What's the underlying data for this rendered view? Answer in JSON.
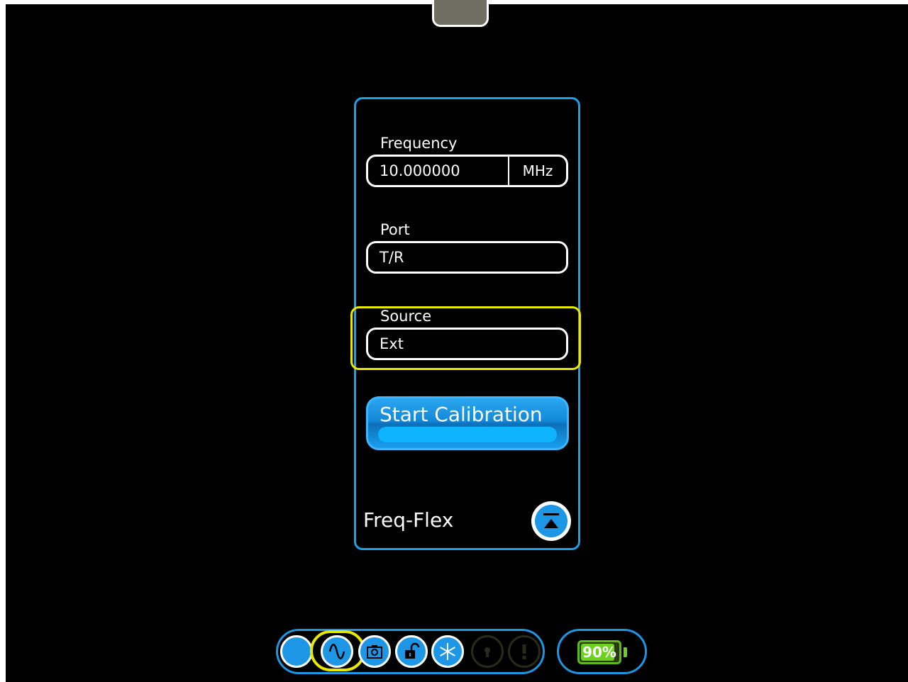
{
  "panel": {
    "frequency": {
      "label": "Frequency",
      "value": "10.000000",
      "unit": "MHz"
    },
    "port": {
      "label": "Port",
      "value": "T/R"
    },
    "source": {
      "label": "Source",
      "value": "Ext"
    },
    "start_button_label": "Start Calibration",
    "title": "Freq-Flex",
    "collapse_icon": "collapse-up-icon"
  },
  "toolbar": {
    "icons": [
      "circle-icon",
      "sine-wave-icon",
      "camera-icon",
      "unlock-icon",
      "snowflake-icon",
      "keyhole-icon",
      "alert-icon"
    ],
    "battery_label": "90%",
    "battery_level": 0.9
  },
  "colors": {
    "accent": "#1e96e6",
    "highlight": "#e8e800",
    "battery": "#6bd21e"
  }
}
